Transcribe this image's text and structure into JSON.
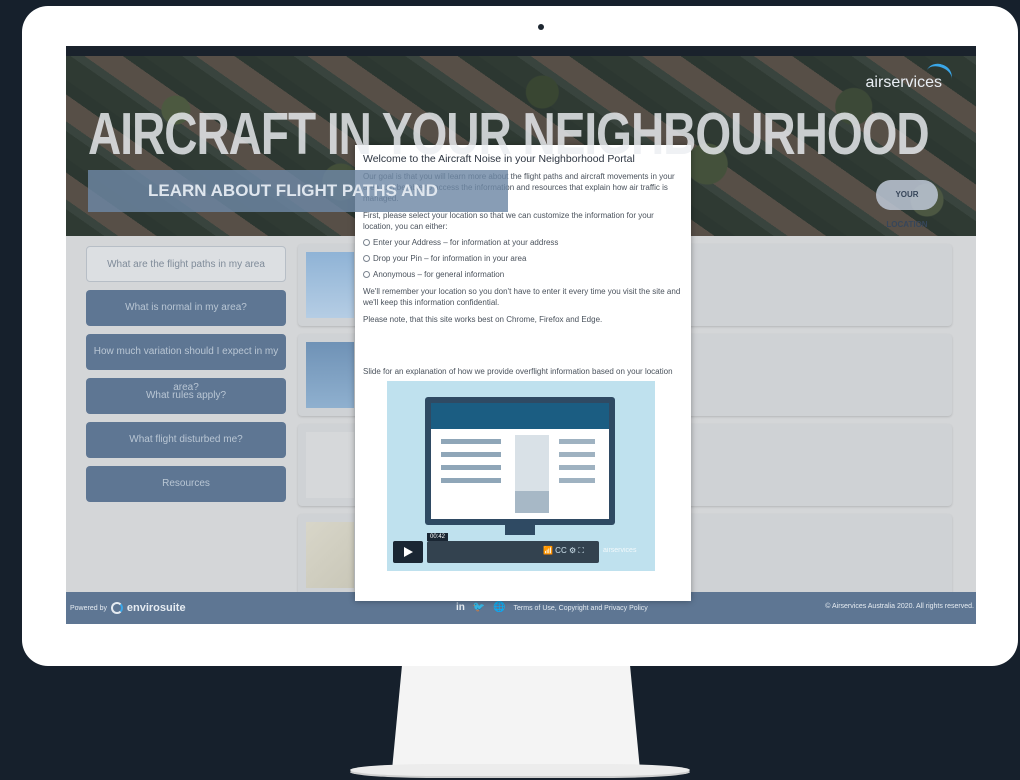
{
  "hero": {
    "title": "AIRCRAFT IN YOUR NEIGHBOURHOOD",
    "subtitle": "LEARN ABOUT FLIGHT PATHS AND",
    "brand": "airservices",
    "location_button": "YOUR LOCATION"
  },
  "nav": {
    "items": [
      {
        "label": "What are the flight paths in my area"
      },
      {
        "label": "What is normal in my area?"
      },
      {
        "label": "How much variation should I expect in my area?"
      },
      {
        "label": "What rules apply?"
      },
      {
        "label": "What flight disturbed me?"
      },
      {
        "label": "Resources"
      }
    ]
  },
  "modal": {
    "title": "Welcome to the Aircraft Noise in your Neighborhood Portal",
    "intro": "Our goal is that you will learn more about the flight paths and aircraft movements in your area and be able to access the information and resources that explain how air traffic is managed.",
    "prompt": "First, please select your location so that we can customize the information for your location, you can either:",
    "options": [
      {
        "label": "Enter your Address – for information at your address"
      },
      {
        "label": "Drop your Pin – for information in your area"
      },
      {
        "label": "Anonymous – for general information"
      }
    ],
    "remember": "We'll remember your location so you don't have to enter it every time you visit the site and we'll keep this information confidential.",
    "browsers": "Please note, that this site works best on Chrome, Firefox and Edge.",
    "slide_label": "Slide for an explanation of how we provide overflight information based on your location",
    "video": {
      "time": "00:42",
      "brand": "airservices"
    }
  },
  "footer": {
    "powered_by": "Powered by",
    "brand": "envirosuite",
    "linkedin": "in",
    "terms": "Terms of Use, Copyright and Privacy Policy",
    "copyright": "© Airservices Australia 2020. All rights reserved."
  }
}
